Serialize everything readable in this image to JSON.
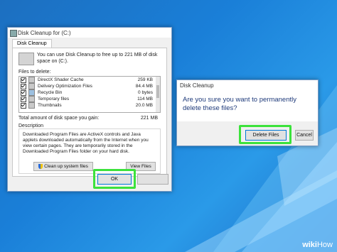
{
  "cleanup_window": {
    "title": "Disk Cleanup for  (C:)",
    "tab": "Disk Cleanup",
    "intro": "You can use Disk Cleanup to free up to 221 MB of disk space on (C:).",
    "files_label": "Files to delete:",
    "files": [
      {
        "name": "DirectX Shader Cache",
        "size": "259 KB",
        "checked": true
      },
      {
        "name": "Delivery Optimization Files",
        "size": "84.4 MB",
        "checked": true
      },
      {
        "name": "Recycle Bin",
        "size": "0 bytes",
        "checked": true
      },
      {
        "name": "Temporary files",
        "size": "114 MB",
        "checked": true
      },
      {
        "name": "Thumbnails",
        "size": "20.0 MB",
        "checked": true
      }
    ],
    "total_label": "Total amount of disk space you gain:",
    "total_value": "221 MB",
    "description_label": "Description",
    "description": "Downloaded Program Files are ActiveX controls and Java applets downloaded automatically from the Internet when you view certain pages. They are temporarily stored in the Downloaded Program Files folder on your hard disk.",
    "cleanup_system_label": "Clean up system files",
    "view_files_label": "View Files",
    "ok_label": "OK"
  },
  "confirm_dialog": {
    "title": "Disk Cleanup",
    "question": "Are you sure you want to permanently delete these files?",
    "delete_label": "Delete Files",
    "cancel_label": "Cancel"
  },
  "watermark": {
    "brand": "wiki",
    "suffix": "How"
  },
  "colors": {
    "highlight": "#3ce23c",
    "desktop": "#1a7fd8",
    "accent": "#0078d7"
  }
}
